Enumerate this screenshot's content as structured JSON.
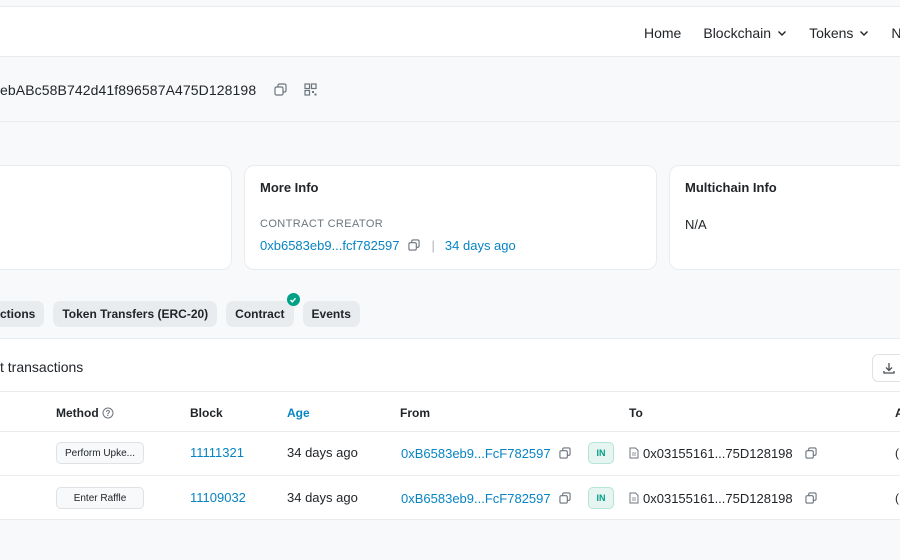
{
  "nav": {
    "items": [
      {
        "label": "Home",
        "has_dropdown": false
      },
      {
        "label": "Blockchain",
        "has_dropdown": true
      },
      {
        "label": "Tokens",
        "has_dropdown": true
      },
      {
        "label": "N",
        "has_dropdown": false
      }
    ]
  },
  "address": {
    "text": "ebABc58B742d41f896587A475D128198",
    "copy_icon": "copy-icon",
    "qr_icon": "qr-code-icon"
  },
  "cards": {
    "more_info": {
      "title": "More Info",
      "creator_label": "CONTRACT CREATOR",
      "creator_address": "0xb6583eb9...fcf782597",
      "separator": "|",
      "creator_age": "34 days ago"
    },
    "multichain": {
      "title": "Multichain Info",
      "value": "N/A"
    }
  },
  "tabs": [
    {
      "label": "ctions"
    },
    {
      "label": "Token Transfers (ERC-20)"
    },
    {
      "label": "Contract",
      "verified": true
    },
    {
      "label": "Events"
    }
  ],
  "transactions": {
    "title": "t transactions",
    "columns": {
      "method": "Method",
      "block": "Block",
      "age": "Age",
      "from": "From",
      "to": "To",
      "edge": "A"
    },
    "rows": [
      {
        "method": "Perform Upke...",
        "block": "11111321",
        "age": "34 days ago",
        "from": "0xB6583eb9...FcF782597",
        "direction": "IN",
        "to": "0x03155161...75D128198",
        "edge": "("
      },
      {
        "method": "Enter Raffle",
        "block": "11109032",
        "age": "34 days ago",
        "from": "0xB6583eb9...FcF782597",
        "direction": "IN",
        "to": "0x03155161...75D128198",
        "edge": "("
      }
    ]
  },
  "colors": {
    "link": "#0784c3",
    "success": "#00a186",
    "muted": "#6c757d",
    "border": "#e9ecef",
    "background": "#f8f9fa"
  }
}
